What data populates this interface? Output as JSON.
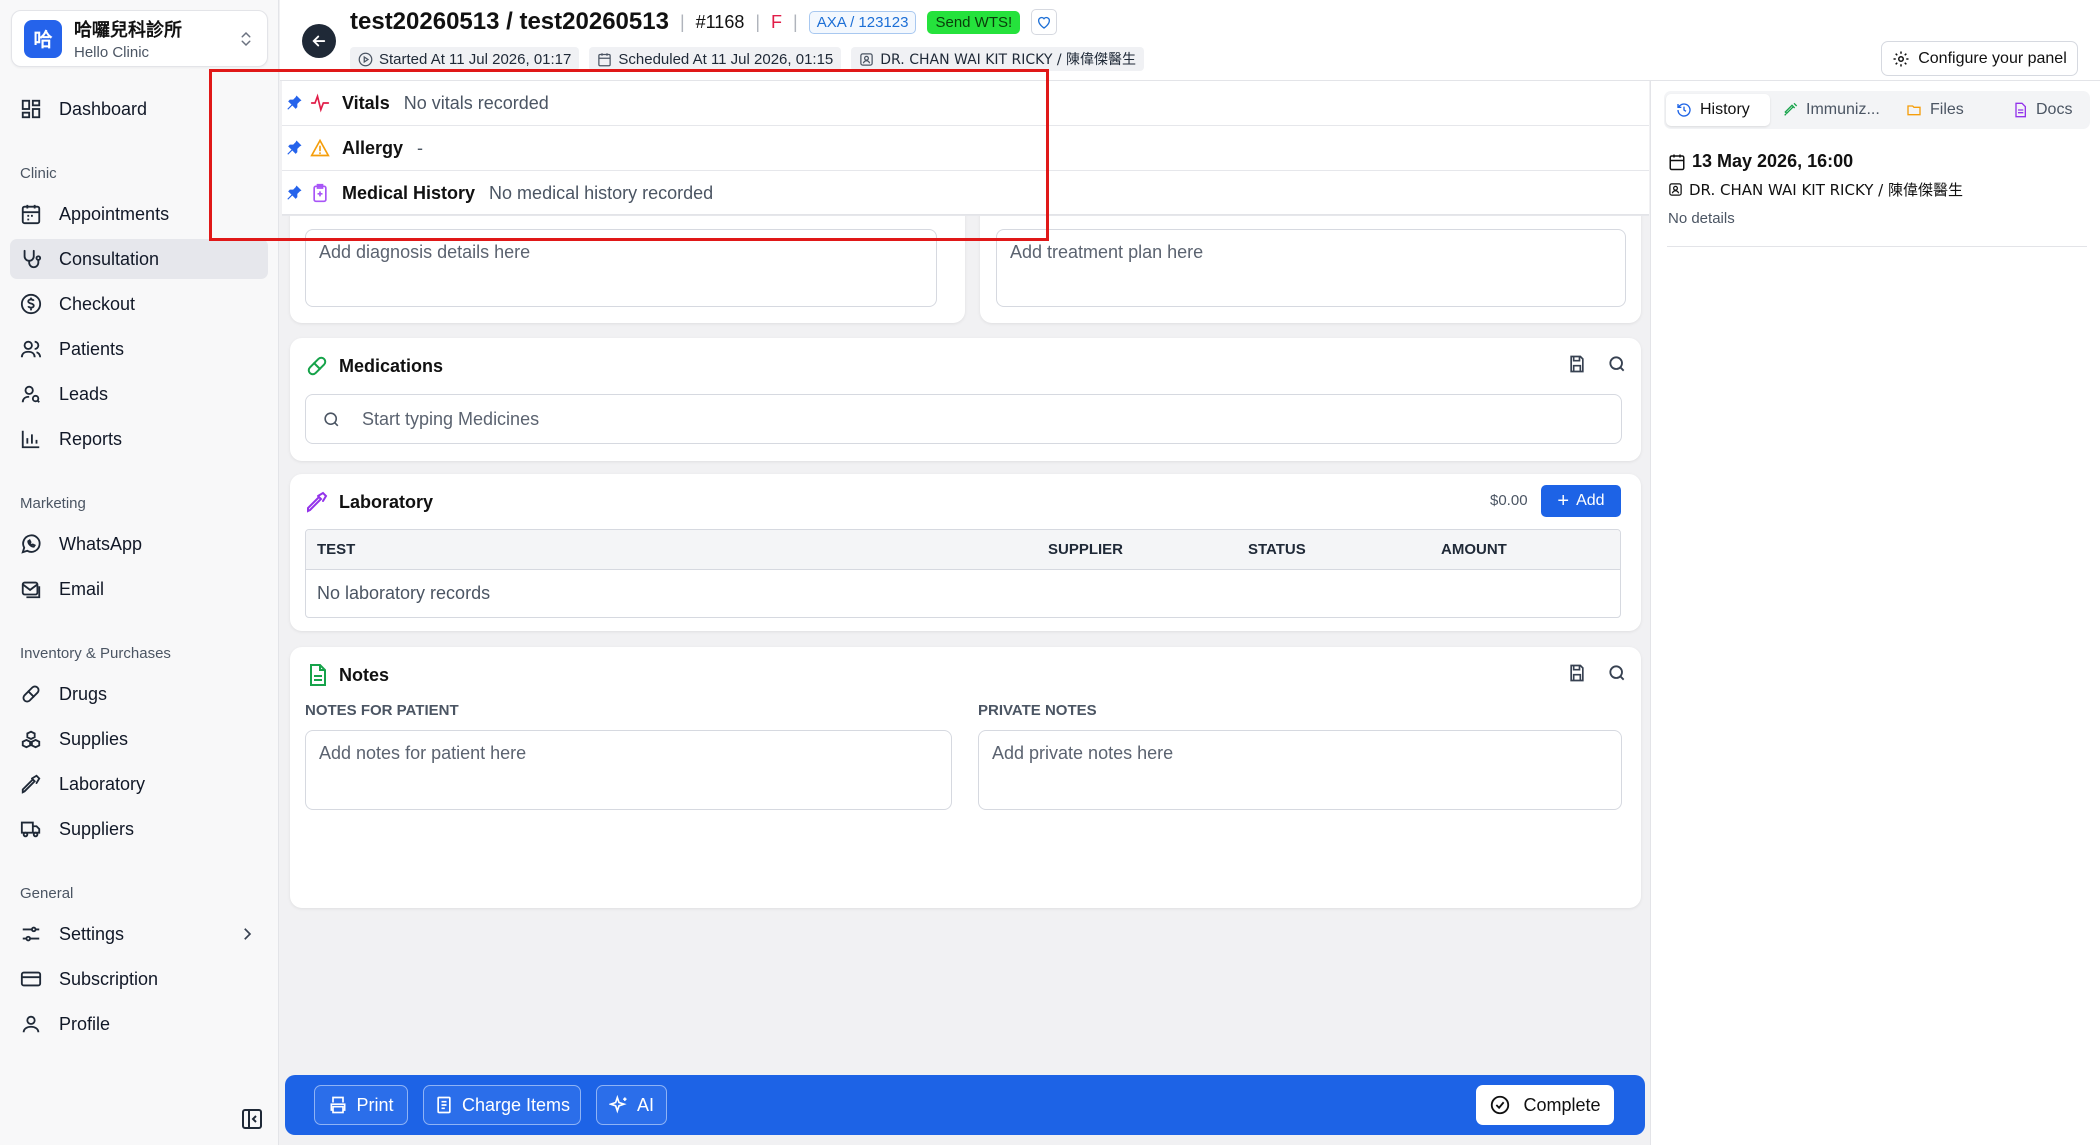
{
  "sidebar": {
    "clinic_logo": "哈",
    "clinic_name": "哈囉兒科診所",
    "clinic_sub": "Hello Clinic",
    "dashboard": "Dashboard",
    "section_clinic": "Clinic",
    "appointments": "Appointments",
    "consultation": "Consultation",
    "checkout": "Checkout",
    "patients": "Patients",
    "leads": "Leads",
    "reports": "Reports",
    "section_marketing": "Marketing",
    "whatsapp": "WhatsApp",
    "email": "Email",
    "section_inventory": "Inventory & Purchases",
    "drugs": "Drugs",
    "supplies": "Supplies",
    "laboratory": "Laboratory",
    "suppliers": "Suppliers",
    "section_general": "General",
    "settings": "Settings",
    "subscription": "Subscription",
    "profile": "Profile"
  },
  "header": {
    "patient_title": "test20260513 / test20260513",
    "patient_number": "#1168",
    "sex": "F",
    "insurance": "AXA / 123123",
    "send_wts": "Send WTS!",
    "started_at": "Started At  11 Jul 2026, 01:17",
    "scheduled_at": "Scheduled At  11 Jul 2026, 01:15",
    "doctor": "DR. CHAN WAI KIT RICKY / 陳偉傑醫生",
    "configure": "Configure your panel"
  },
  "pinned": {
    "vitals_label": "Vitals",
    "vitals_value": "No vitals recorded",
    "allergy_label": "Allergy",
    "allergy_value": "-",
    "history_label": "Medical History",
    "history_value": "No medical history recorded"
  },
  "diagnosis": {
    "placeholder": "Add diagnosis details here"
  },
  "treatment": {
    "placeholder": "Add treatment plan here"
  },
  "medications": {
    "title": "Medications",
    "placeholder": "Start typing Medicines"
  },
  "laboratory": {
    "title": "Laboratory",
    "total": "$0.00",
    "add": "Add",
    "columns": [
      "TEST",
      "SUPPLIER",
      "STATUS",
      "AMOUNT"
    ],
    "empty": "No laboratory records"
  },
  "notes": {
    "title": "Notes",
    "patient_label": "NOTES FOR PATIENT",
    "patient_placeholder": "Add notes for patient here",
    "private_label": "PRIVATE NOTES",
    "private_placeholder": "Add private notes here"
  },
  "bottom": {
    "print": "Print",
    "charge_items": "Charge Items",
    "ai": "AI",
    "complete": "Complete"
  },
  "right_panel": {
    "tabs": [
      "History",
      "Immuniz...",
      "Files",
      "Docs"
    ],
    "entry_date": "13 May 2026, 16:00",
    "entry_doctor": "DR. CHAN WAI KIT RICKY / 陳偉傑醫生",
    "entry_details": "No details"
  },
  "colors": {
    "accent": "#1d63e6",
    "highlight": "#e01818",
    "wts": "#25e23c"
  }
}
